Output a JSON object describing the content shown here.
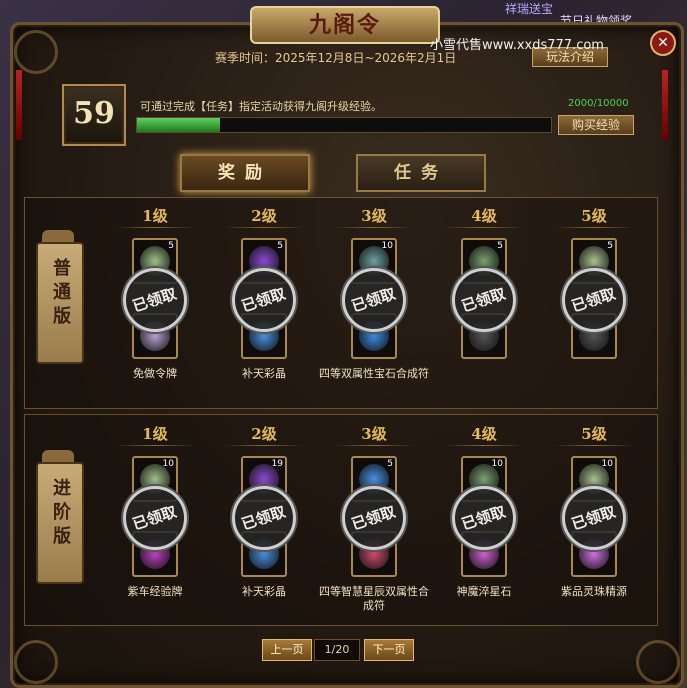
{
  "window": {
    "title": "九阁令",
    "close_icon": "close-icon"
  },
  "background": {
    "top_text_1": "祥瑞送宝",
    "top_text_2": "节日礼物领奖"
  },
  "watermark": "小雪代售www.xxds777.com",
  "season": {
    "text": "赛季时间：2025年12月8日~2026年2月1日"
  },
  "buttons": {
    "rules": "玩法介绍",
    "buy_exp": "购买经验",
    "prev_page": "上一页",
    "next_page": "下一页"
  },
  "level": {
    "value": "59"
  },
  "progress": {
    "description": "可通过完成【任务】指定活动获得九阁升级经验。",
    "exp_text": "2000/10000",
    "fraction": 0.2,
    "color": "#3ec43e"
  },
  "tabs": [
    {
      "label": "奖励",
      "active": true
    },
    {
      "label": "任务",
      "active": false
    }
  ],
  "tiers": [
    {
      "label": "普通版",
      "levels": [
        {
          "level": "1级",
          "top_count": "5",
          "item_name": "免做令牌",
          "claimed": "已领取",
          "colors": [
            "#9fbf8a",
            "#b8a0d0"
          ]
        },
        {
          "level": "2级",
          "top_count": "5",
          "item_name": "补天彩晶",
          "claimed": "已领取",
          "colors": [
            "#8a4ad0",
            "#4a90e0"
          ]
        },
        {
          "level": "3级",
          "top_count": "10",
          "item_name": "四等双属性宝石合成符",
          "claimed": "已领取",
          "colors": [
            "#6aa0a0",
            "#3a8ae0"
          ]
        },
        {
          "level": "4级",
          "top_count": "5",
          "item_name": "",
          "claimed": "已领取",
          "colors": [
            "#7aa070",
            "#555"
          ]
        },
        {
          "level": "5级",
          "top_count": "5",
          "item_name": "",
          "claimed": "已领取",
          "colors": [
            "#aabf90",
            "#555"
          ]
        }
      ]
    },
    {
      "label": "进阶版",
      "levels": [
        {
          "level": "1级",
          "top_count": "10",
          "item_name": "紫车经验牌",
          "claimed": "已领取",
          "colors": [
            "#9fbf8a",
            "#c040c0"
          ]
        },
        {
          "level": "2级",
          "top_count": "19",
          "item_name": "补天彩晶",
          "claimed": "已领取",
          "colors": [
            "#8a4ad0",
            "#4a90e0"
          ]
        },
        {
          "level": "3级",
          "top_count": "5",
          "item_name": "四等智慧星辰双属性合成符",
          "claimed": "已领取",
          "colors": [
            "#4a90e0",
            "#d04a70"
          ]
        },
        {
          "level": "4级",
          "top_count": "10",
          "item_name": "神魔淬星石",
          "claimed": "已领取",
          "colors": [
            "#7aa070",
            "#d060d0"
          ]
        },
        {
          "level": "5级",
          "top_count": "10",
          "item_name": "紫品灵珠精源",
          "claimed": "已领取",
          "colors": [
            "#aabf90",
            "#d070e0"
          ]
        }
      ]
    }
  ],
  "pager": {
    "value": "1/20"
  }
}
